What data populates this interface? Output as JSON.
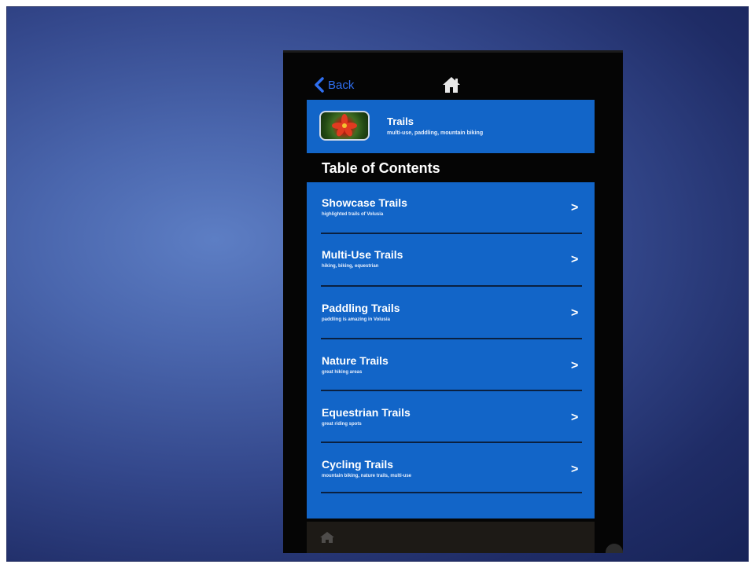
{
  "nav": {
    "back_label": "Back",
    "back_icon": "chevron-left-icon",
    "home_icon": "home-icon"
  },
  "header": {
    "title": "Trails",
    "subtitle": "multi-use, paddling, mountain biking",
    "thumbnail": "flower-image"
  },
  "toc": {
    "heading": "Table of Contents",
    "items": [
      {
        "title": "Showcase Trails",
        "subtitle": "highlighted trails of Volusia"
      },
      {
        "title": "Multi-Use Trails",
        "subtitle": "hiking, biking, equestrian"
      },
      {
        "title": "Paddling Trails",
        "subtitle": "paddling is amazing in Volusia"
      },
      {
        "title": "Nature Trails",
        "subtitle": "great hiking areas"
      },
      {
        "title": "Equestrian Trails",
        "subtitle": "great riding spots"
      },
      {
        "title": "Cycling Trails",
        "subtitle": "mountain biking, nature trails, multi-use"
      }
    ]
  },
  "colors": {
    "accent_blue": "#1265c8",
    "back_blue": "#2f6ff0",
    "background": "#050505"
  }
}
